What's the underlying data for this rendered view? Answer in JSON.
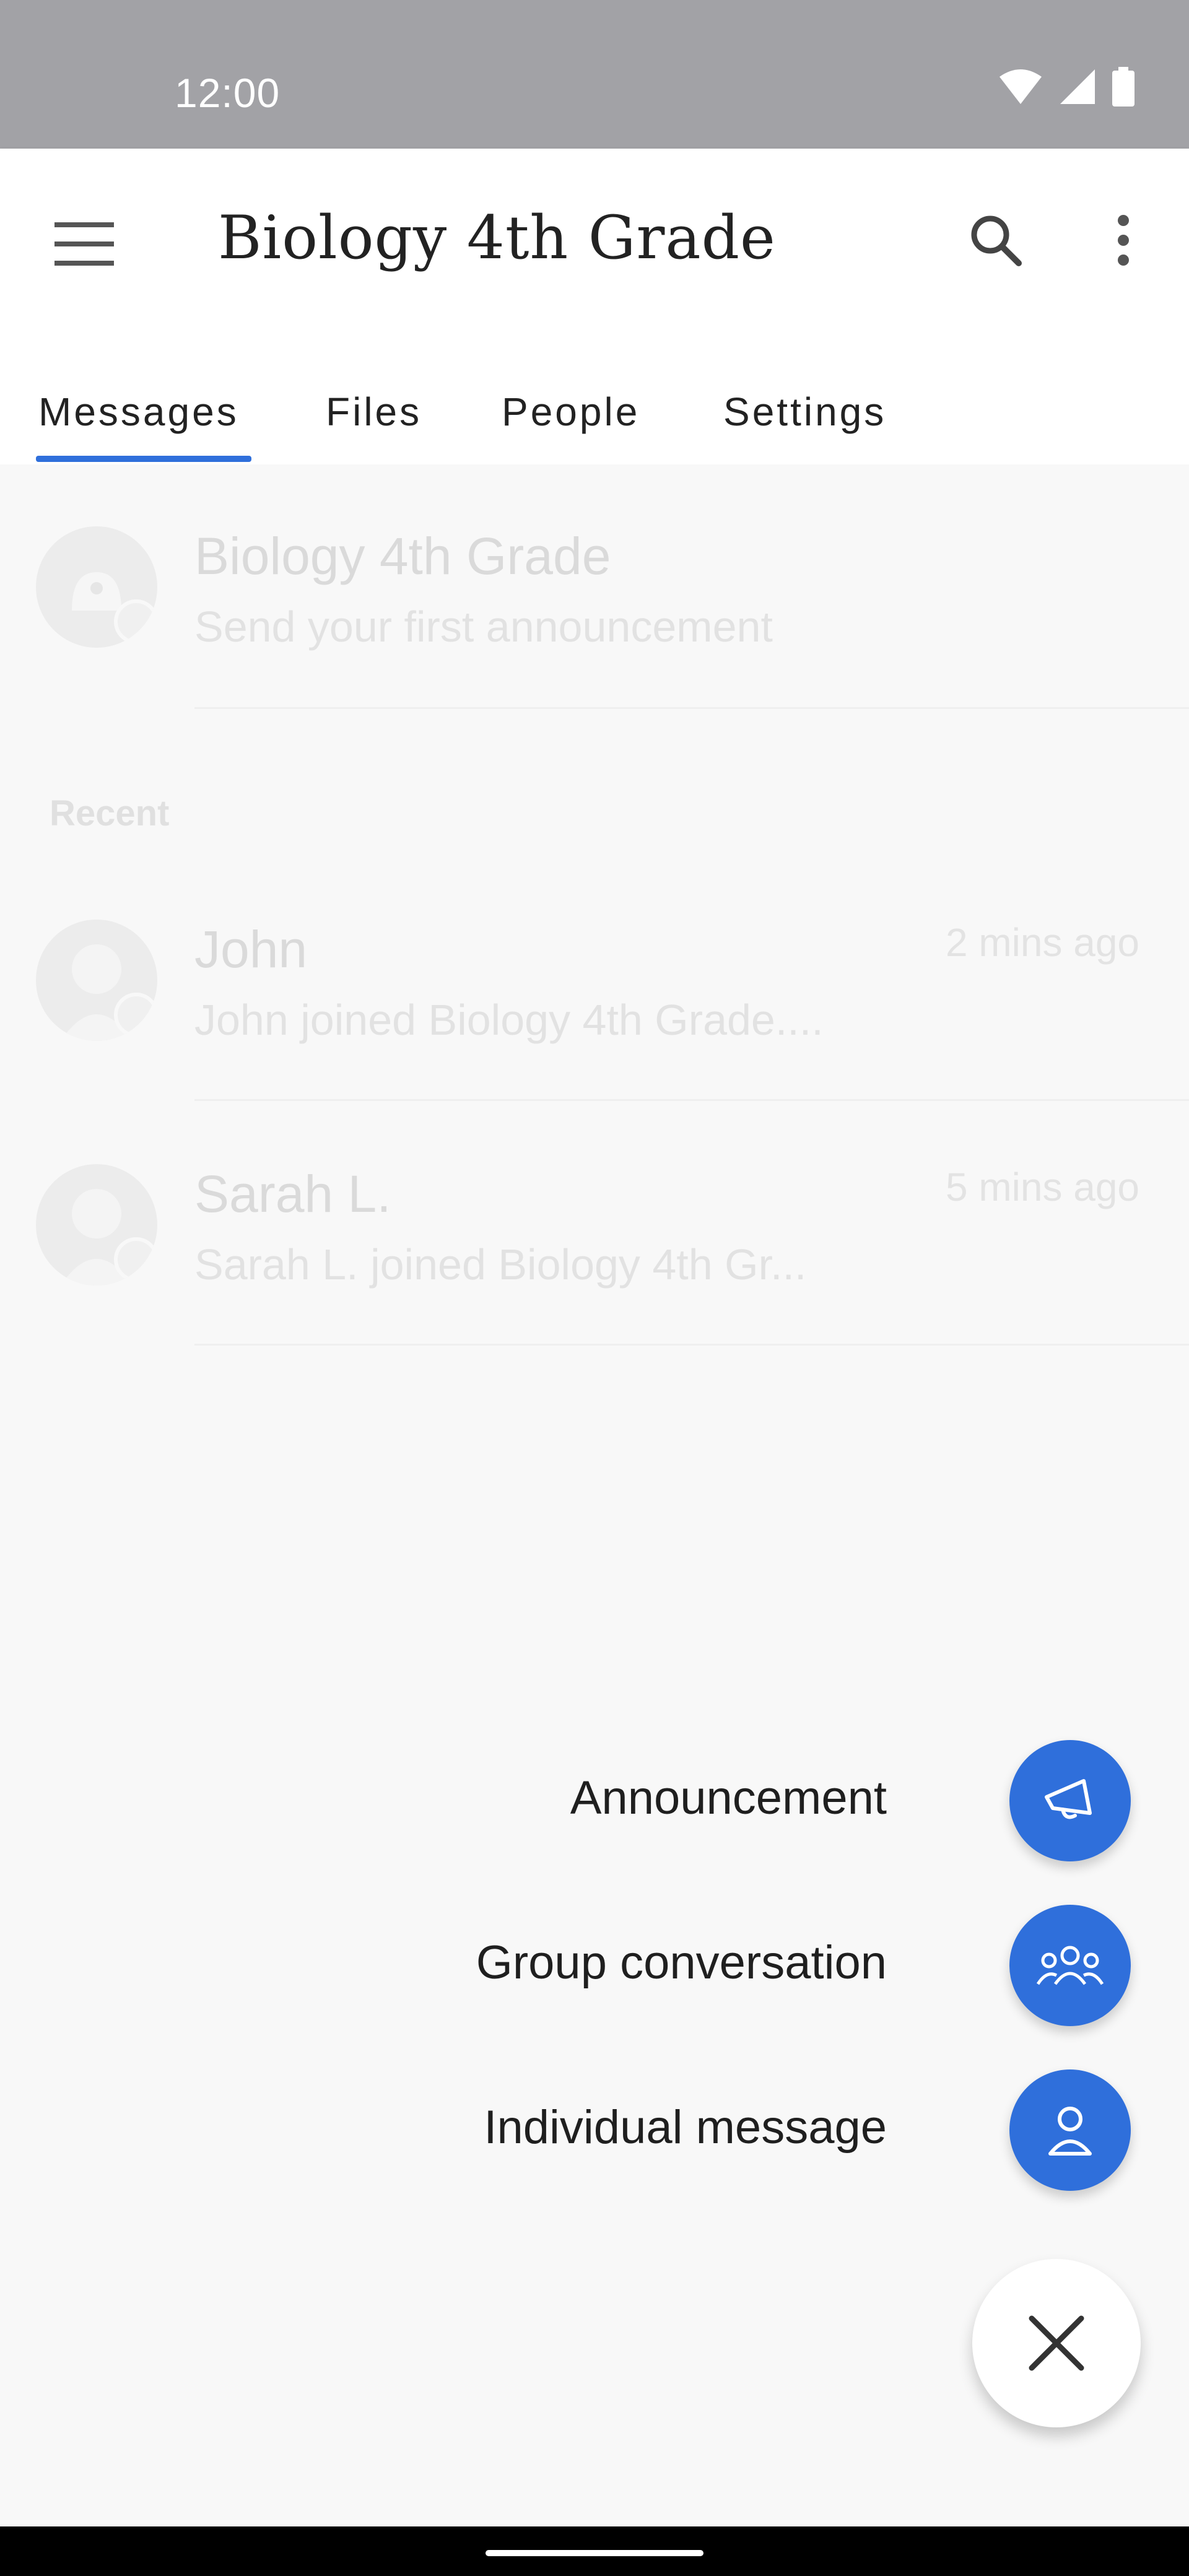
{
  "status_bar": {
    "time": "12:00"
  },
  "app_bar": {
    "title": "Biology 4th Grade"
  },
  "tabs": [
    {
      "label": "Messages"
    },
    {
      "label": "Files"
    },
    {
      "label": "People"
    },
    {
      "label": "Settings"
    }
  ],
  "announcement_row": {
    "title": "Biology 4th Grade",
    "subtitle": "Send your first announcement"
  },
  "section": {
    "recent": "Recent"
  },
  "recent": [
    {
      "name": "John",
      "message": "John joined Biology 4th Grade....",
      "time": "2 mins ago"
    },
    {
      "name": "Sarah L.",
      "message": "Sarah L. joined Biology 4th Gr...",
      "time": "5 mins ago"
    }
  ],
  "fab_menu": {
    "announcement": "Announcement",
    "group": "Group conversation",
    "individual": "Individual message"
  },
  "colors": {
    "accent": "#2f6fdb"
  }
}
